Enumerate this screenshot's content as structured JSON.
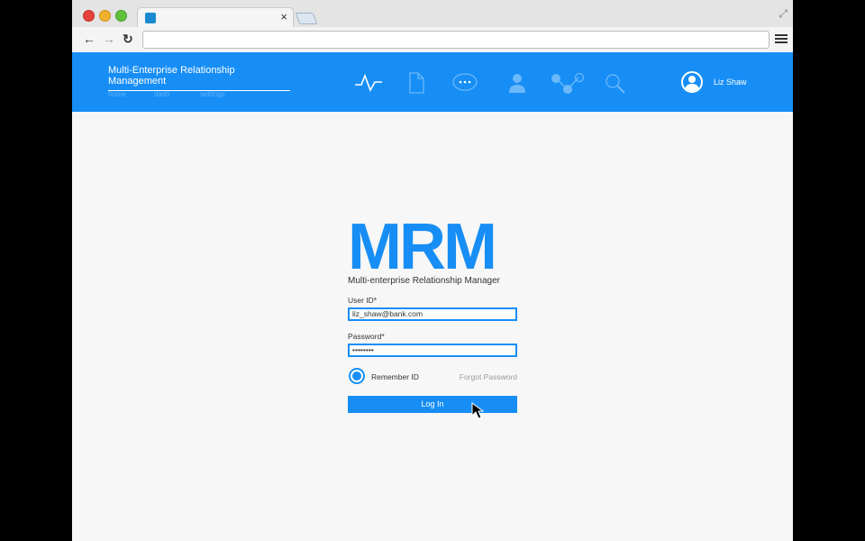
{
  "browser": {
    "tab_close": "×",
    "fullscreen": "⤢",
    "nav": {
      "back": "←",
      "forward": "→",
      "reload": "↻"
    },
    "url": ""
  },
  "header": {
    "title": "Multi-Enterprise Relationship Management",
    "subnav": [
      "home",
      "dash",
      "settings"
    ],
    "icons": [
      "activity-icon",
      "document-icon",
      "chat-icon",
      "person-icon",
      "network-icon",
      "search-icon"
    ],
    "user_name": "Liz Shaw",
    "accent": "#178ef5"
  },
  "login": {
    "logo": "MRM",
    "subtitle": "Multi-enterprise Relationship Manager",
    "user_id_label": "User ID*",
    "user_id_value": "liz_shaw@bank.com",
    "password_label": "Password*",
    "password_value": "••••••••",
    "remember_label": "Remember ID",
    "remember_checked": true,
    "forgot_label": "Forgot Password",
    "login_label": "Log In"
  }
}
